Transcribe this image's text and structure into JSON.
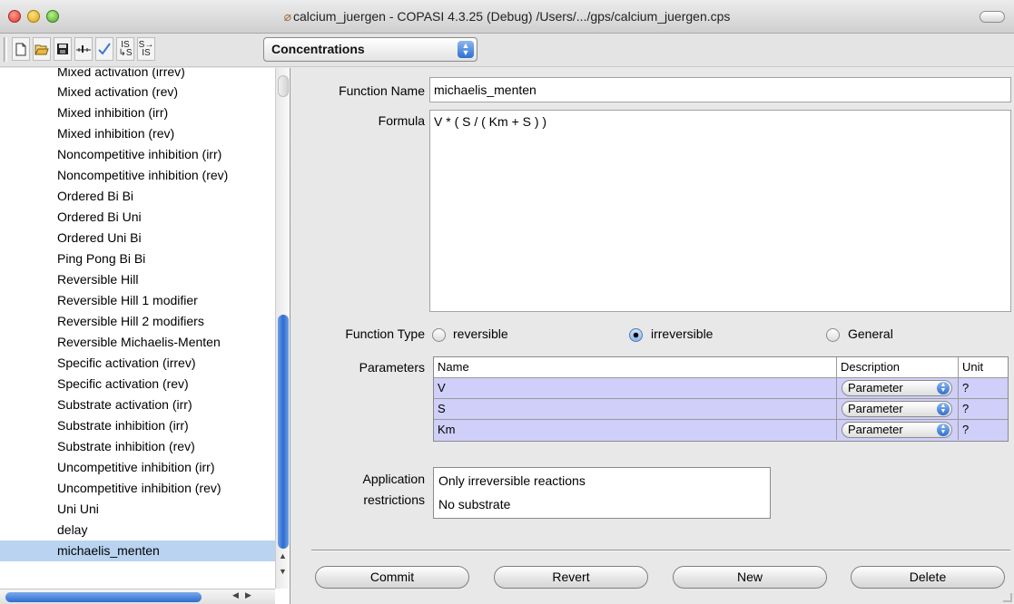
{
  "window": {
    "title": "calcium_juergen - COPASI 4.3.25 (Debug) /Users/.../gps/calcium_juergen.cps"
  },
  "toolbar": {
    "buttons": [
      {
        "name": "new-file-icon",
        "glyph": "🗋"
      },
      {
        "name": "open-folder-icon",
        "glyph": "📂"
      },
      {
        "name": "save-icon",
        "glyph": "💾"
      },
      {
        "name": "slider-icon",
        "glyph": "⊥"
      },
      {
        "name": "check-icon",
        "glyph": "✓"
      },
      {
        "name": "is-s-icon",
        "glyph": "IS"
      },
      {
        "name": "s-is-icon",
        "glyph": "S"
      }
    ],
    "combo_value": "Concentrations"
  },
  "function_list": {
    "items": [
      "Mixed activation (irrev)",
      "Mixed activation (rev)",
      "Mixed inhibition (irr)",
      "Mixed inhibition (rev)",
      "Noncompetitive inhibition (irr)",
      "Noncompetitive inhibition (rev)",
      "Ordered Bi Bi",
      "Ordered Bi Uni",
      "Ordered Uni Bi",
      "Ping Pong Bi Bi",
      "Reversible Hill",
      "Reversible Hill 1 modifier",
      "Reversible Hill 2 modifiers",
      "Reversible Michaelis-Menten",
      "Specific activation (irrev)",
      "Specific activation (rev)",
      "Substrate activation (irr)",
      "Substrate inhibition (irr)",
      "Substrate inhibition (rev)",
      "Uncompetitive inhibition (irr)",
      "Uncompetitive inhibition (rev)",
      "Uni Uni",
      "delay",
      "michaelis_menten"
    ],
    "selected": "michaelis_menten"
  },
  "editor": {
    "function_name_label": "Function Name",
    "function_name_value": "michaelis_menten",
    "formula_label": "Formula",
    "formula_value": "V * ( S / ( Km + S ) )",
    "function_type_label": "Function Type",
    "types": [
      {
        "label": "reversible",
        "checked": false
      },
      {
        "label": "irreversible",
        "checked": true
      },
      {
        "label": "General",
        "checked": false
      }
    ],
    "parameters_label": "Parameters",
    "parameters": {
      "headers": [
        "Name",
        "Description",
        "Unit"
      ],
      "rows": [
        {
          "name": "V",
          "description": "Parameter",
          "unit": "?"
        },
        {
          "name": "S",
          "description": "Parameter",
          "unit": "?"
        },
        {
          "name": "Km",
          "description": "Parameter",
          "unit": "?"
        }
      ]
    },
    "restrictions_label_line1": "Application",
    "restrictions_label_line2": "restrictions",
    "restrictions": [
      "Only irreversible reactions",
      "No substrate"
    ]
  },
  "buttons": {
    "commit": "Commit",
    "revert": "Revert",
    "new": "New",
    "delete": "Delete"
  }
}
